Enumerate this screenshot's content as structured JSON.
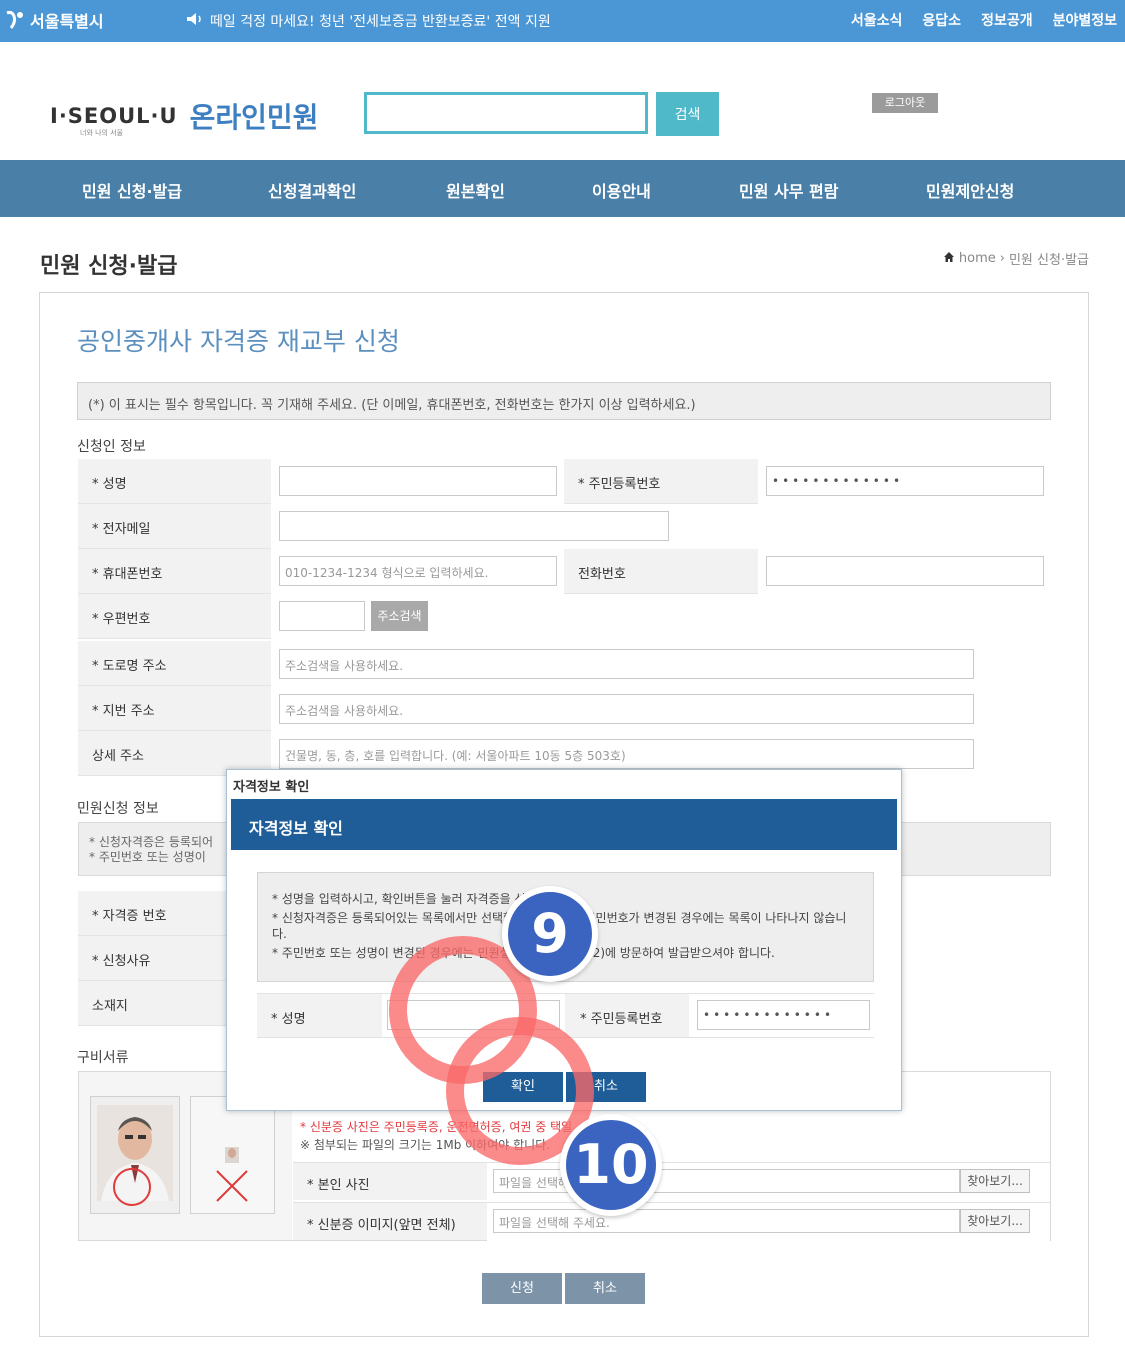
{
  "topbar": {
    "logo": "서울특별시",
    "notice": "떼일 걱정 마세요! 청년 '전세보증금 반환보증료' 전액 지원",
    "links": [
      "서울소식",
      "응답소",
      "정보공개",
      "분야별정보"
    ]
  },
  "header": {
    "brand_iseoul": "I·SEOUL·U",
    "brand_sub": "너와 나의 서울",
    "brand_title": "온라인민원",
    "search_placeholder": "",
    "search_button": "검색",
    "logout_button": "로그아웃"
  },
  "nav": [
    "민원 신청·발급",
    "신청결과확인",
    "원본확인",
    "이용안내",
    "민원 사무 편람",
    "민원제안신청"
  ],
  "page": {
    "title": "민원 신청·발급",
    "breadcrumb_home": "home",
    "breadcrumb_current": "민원 신청·발급"
  },
  "form": {
    "title": "공인중개사 자격증 재교부 신청",
    "required_note": "(*) 이 표시는 필수 항목입니다. 꼭 기재해 주세요. (단 이메일, 휴대폰번호, 전화번호는 한가지 이상 입력하세요.)",
    "applicant_section": "신청인 정보",
    "fields": {
      "name": "* 성명",
      "rrn": "* 주민등록번호",
      "rrn_value": "•••••••••••••",
      "email": "* 전자메일",
      "mobile": "* 휴대폰번호",
      "mobile_placeholder": "010-1234-1234 형식으로 입력하세요.",
      "phone": "전화번호",
      "zipcode": "* 우편번호",
      "address_search": "주소검색",
      "road_address": "* 도로명 주소",
      "road_placeholder": "주소검색을 사용하세요.",
      "lot_address": "* 지번 주소",
      "lot_placeholder": "주소검색을 사용하세요.",
      "detail_address": "상세 주소",
      "detail_placeholder": "건물명, 동, 층, 호를 입력합니다. (예: 서울아파트 10동 5층 503호)"
    },
    "request_section": "민원신청 정보",
    "request_info_1": "* 신청자격증은 등록되어",
    "request_info_2": "* 주민번호 또는 성명이",
    "license_no": "* 자격증 번호",
    "reason": "* 신청사유",
    "location": "소재지",
    "docs_section": "구비서류",
    "docs_red_note": "* 신분증 사진은 주민등록증, 운전면허증, 여권 중 택일",
    "docs_gray_note": "※ 첨부되는 파일의 크기는 1Mb 이하여야 합니다.",
    "photo_label": "* 본인 사진",
    "photo_placeholder": "파일을 선택해 주세요.",
    "id_label": "* 신분증 이미지(앞면 전체)",
    "id_placeholder": "파일을 선택해 주세요.",
    "find_button": "찾아보기...",
    "submit_button": "신청",
    "cancel_button": "취소"
  },
  "modal": {
    "window_title": "자격정보 확인",
    "header": "자격정보 확인",
    "info_1": "* 성명을 입력하시고, 확인버튼을 눌러 자격증을 선택하세요.",
    "info_2": "* 신청자격증은 등록되어있는 목록에서만 선택할 수 있습니다. 주민번호가 변경된 경우에는 목록이 나타나지 않습니다.",
    "info_3": "* 주민번호 또는 성명이 변경된 경우에는 민원실(02-2133-7902)에 방문하여 발급받으셔야 합니다.",
    "name_label": "* 성명",
    "rrn_label": "* 주민등록번호",
    "rrn_value": "•••••••••••••",
    "confirm_button": "확인",
    "cancel_button": "취소"
  },
  "annotations": {
    "badge_9": "9",
    "badge_10": "10"
  },
  "colors": {
    "topbar": "#4b97d6",
    "nav": "#4a7fa8",
    "modal_header": "#1e5d98",
    "accent": "#4fb9c9",
    "annotation_ring": "#fa6969",
    "annotation_badge": "#3b64c1"
  }
}
